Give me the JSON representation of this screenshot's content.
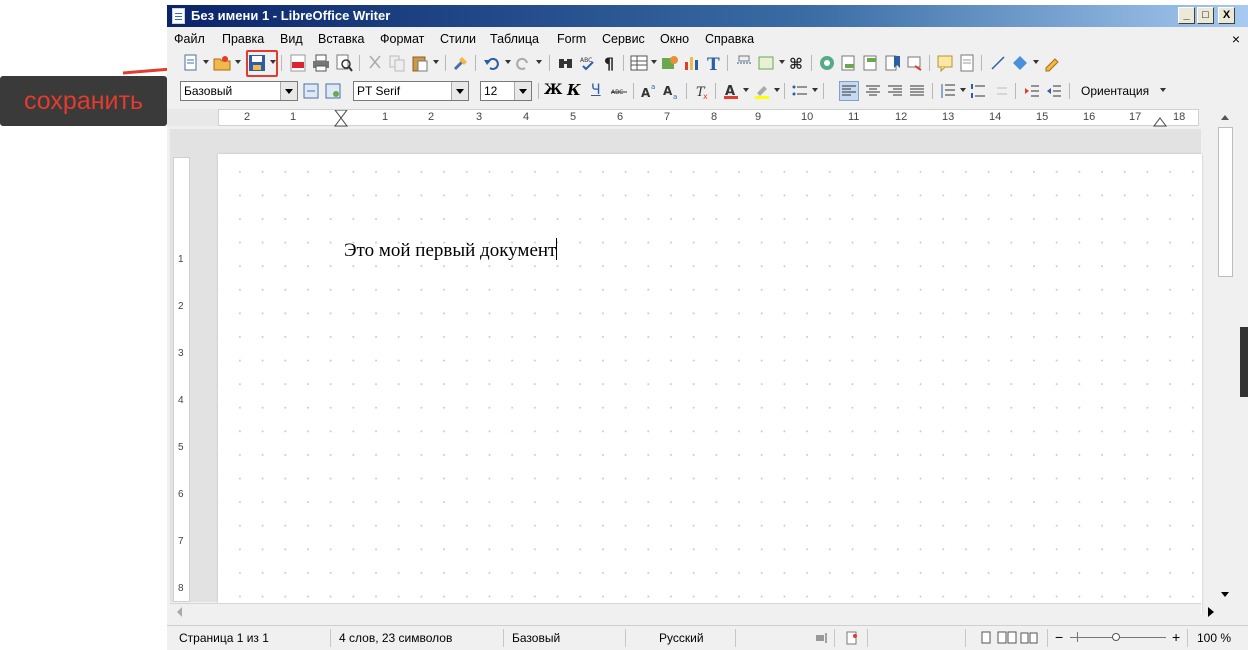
{
  "annotation": {
    "callout_text": "сохранить",
    "accent": "#e33b2e"
  },
  "window": {
    "title": "Без имени 1 - LibreOffice Writer",
    "buttons": {
      "minimize": "_",
      "maximize": "□",
      "close": "X"
    }
  },
  "menu": {
    "items": [
      "Файл",
      "Правка",
      "Вид",
      "Вставка",
      "Формат",
      "Стили",
      "Таблица",
      "Form",
      "Сервис",
      "Окно",
      "Справка"
    ],
    "close_glyph": "×"
  },
  "toolbar2": {
    "style_value": "Базовый",
    "font_value": "PT Serif",
    "size_value": "12",
    "bold": "Ж",
    "italic": "К",
    "underline": "Ч",
    "orientation_label": "Ориентация"
  },
  "ruler": {
    "ticks": [
      "2",
      "1",
      "1",
      "2",
      "3",
      "4",
      "5",
      "6",
      "7",
      "8",
      "9",
      "10",
      "11",
      "12",
      "13",
      "14",
      "15",
      "16",
      "17",
      "18"
    ]
  },
  "vruler": {
    "ticks": [
      "1",
      "2",
      "3",
      "4",
      "5",
      "6",
      "7",
      "8"
    ]
  },
  "document": {
    "text": "Это мой первый документ"
  },
  "status": {
    "page": "Страница 1 из 1",
    "words": "4 слов, 23 символов",
    "style": "Базовый",
    "language": "Русский",
    "zoom": "100 %"
  }
}
